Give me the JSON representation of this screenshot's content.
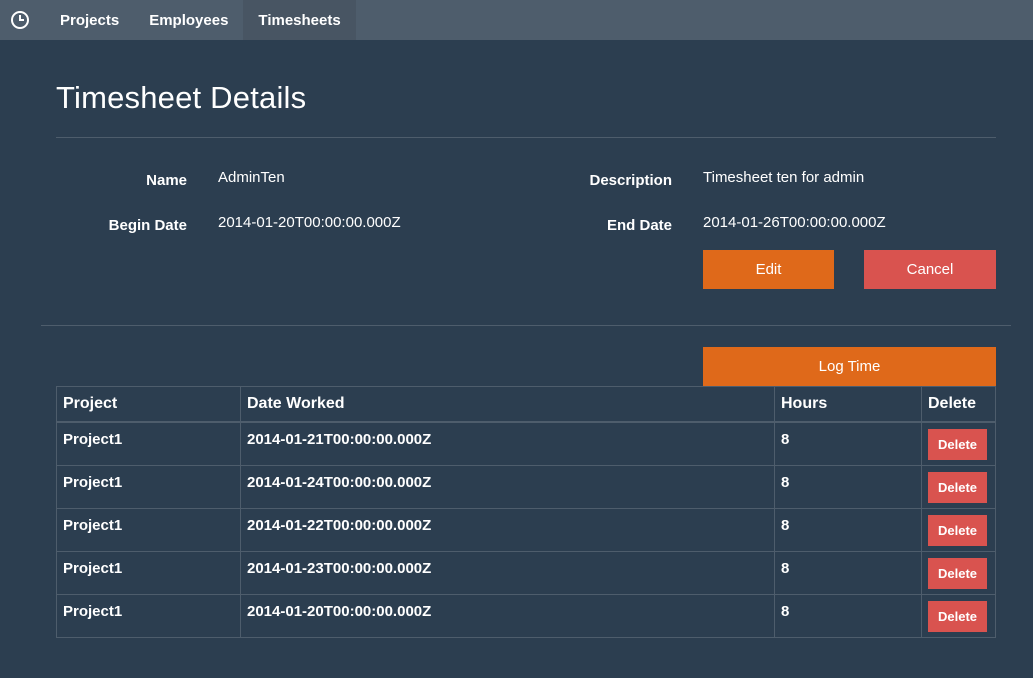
{
  "nav": {
    "brand_icon": "clock-icon",
    "items": [
      {
        "label": "Projects"
      },
      {
        "label": "Employees"
      },
      {
        "label": "Timesheets"
      }
    ],
    "active": "Timesheets"
  },
  "page": {
    "title": "Timesheet Details"
  },
  "details": {
    "name_label": "Name",
    "name_value": "AdminTen",
    "description_label": "Description",
    "description_value": "Timesheet ten for admin",
    "begin_label": "Begin Date",
    "begin_value": "2014-01-20T00:00:00.000Z",
    "end_label": "End Date",
    "end_value": "2014-01-26T00:00:00.000Z"
  },
  "actions": {
    "edit_label": "Edit",
    "cancel_label": "Cancel",
    "log_time_label": "Log Time"
  },
  "table": {
    "headers": [
      "Project",
      "Date Worked",
      "Hours",
      "Delete"
    ],
    "rows": [
      {
        "project": "Project1",
        "date": "2014-01-21T00:00:00.000Z",
        "hours": "8",
        "delete_label": "Delete"
      },
      {
        "project": "Project1",
        "date": "2014-01-24T00:00:00.000Z",
        "hours": "8",
        "delete_label": "Delete"
      },
      {
        "project": "Project1",
        "date": "2014-01-22T00:00:00.000Z",
        "hours": "8",
        "delete_label": "Delete"
      },
      {
        "project": "Project1",
        "date": "2014-01-23T00:00:00.000Z",
        "hours": "8",
        "delete_label": "Delete"
      },
      {
        "project": "Project1",
        "date": "2014-01-20T00:00:00.000Z",
        "hours": "8",
        "delete_label": "Delete"
      }
    ]
  },
  "colors": {
    "background": "#2c3e50",
    "navbar": "#4e5d6c",
    "warning": "#df691a",
    "danger": "#d9534f"
  }
}
